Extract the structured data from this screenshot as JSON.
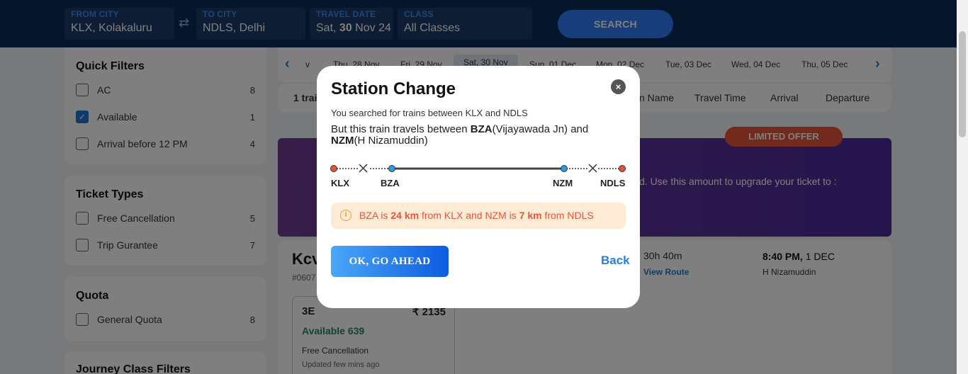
{
  "search": {
    "from_label": "FROM CITY",
    "from_value": "KLX, Kolakaluru",
    "to_label": "TO CITY",
    "to_value": "NDLS, Delhi",
    "date_label": "TRAVEL DATE",
    "date_value_pre": "Sat,",
    "date_value_day": "30",
    "date_value_post": "Nov 24",
    "class_label": "CLASS",
    "class_value": "All Classes",
    "search_button": "SEARCH"
  },
  "quick_filters": {
    "title": "Quick Filters",
    "items": [
      {
        "label": "AC",
        "count": "8",
        "checked": false
      },
      {
        "label": "Available",
        "count": "1",
        "checked": true
      },
      {
        "label": "Arrival before 12 PM",
        "count": "4",
        "checked": false
      }
    ]
  },
  "ticket_types": {
    "title": "Ticket Types",
    "items": [
      {
        "label": "Free Cancellation",
        "count": "5"
      },
      {
        "label": "Trip Gurantee",
        "count": "7"
      }
    ]
  },
  "quota": {
    "title": "Quota",
    "items": [
      {
        "label": "General Quota",
        "count": "8"
      }
    ]
  },
  "journey_class": {
    "title": "Journey Class Filters"
  },
  "dates": [
    "v",
    "Thu, 28 Nov",
    "Fri, 29 Nov",
    "Sat, 30 Nov",
    "Sun, 01 Dec",
    "Mon, 02 Dec",
    "Tue, 03 Dec",
    "Wed, 04 Dec",
    "Thu, 05 Dec"
  ],
  "sort": {
    "count": "1 trai",
    "options": [
      "n Name",
      "Travel Time",
      "Arrival",
      "Departure"
    ]
  },
  "offer": {
    "badge": "LIMITED OFFER",
    "text": "d. Use this amount to upgrade your ticket to :"
  },
  "train": {
    "name": "Kcv",
    "number": "#0607",
    "duration": "30h 40m",
    "view_route": "View Route",
    "arrival_time": "8:40 PM,",
    "arrival_date": "1 DEC",
    "arrival_station": "H Nizamuddin",
    "class_card": {
      "class": "3E",
      "price": "₹ 2135",
      "availability": "Available 639",
      "cancellation": "Free Cancellation",
      "updated": "Updated few mins ago"
    }
  },
  "modal": {
    "title": "Station Change",
    "close_icon": "×",
    "line1": "You searched for trains between KLX and NDLS",
    "line2_pre": "But this train travels between ",
    "line2_bza": "BZA",
    "line2_bza_name": "(Vijayawada Jn) and",
    "line2_nzm": "NZM",
    "line2_nzm_name": "(H Nizamuddin)",
    "stations": [
      "KLX",
      "BZA",
      "NZM",
      "NDLS"
    ],
    "info": {
      "icon": "i",
      "p1": "BZA is ",
      "d1": "24 km",
      "p2": " from KLX and  NZM is ",
      "d2": "7 km",
      "p3": " from NDLS"
    },
    "ok_button": "OK, GO AHEAD",
    "back_link": "Back"
  },
  "colors": {
    "navy": "#0b2b59",
    "accent_blue": "#2176d2",
    "endpoint_red": "#e8523a",
    "station_blue": "#2e9be0",
    "info_bg": "#fdebd6",
    "info_text": "#e3573d"
  }
}
